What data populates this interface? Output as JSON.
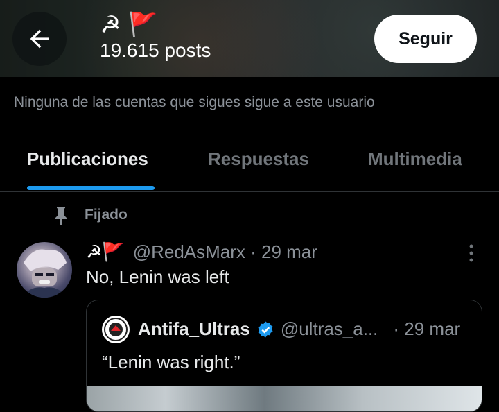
{
  "header": {
    "title_hammer_sickle": "☭",
    "title_flag": "🚩",
    "posts_count": "19.615 posts",
    "follow_label": "Seguir"
  },
  "follows_note": "Ninguna de las cuentas que sigues sigue a este usuario",
  "tabs": [
    {
      "label": "Publicaciones",
      "active": true
    },
    {
      "label": "Respuestas",
      "active": false
    },
    {
      "label": "Multimedia",
      "active": false
    }
  ],
  "pinned_label": "Fijado",
  "tweet": {
    "name_hammer_sickle": "☭",
    "name_flag": "🚩",
    "handle_time": "@RedAsMarx · 29 mar",
    "text": "No, Lenin was left",
    "quote": {
      "name": "Antifa_Ultras",
      "handle": "@ultras_a...",
      "time": "· 29 mar",
      "text": "“Lenin was right.”"
    }
  },
  "colors": {
    "accent": "#1d9bf0",
    "flag_red": "#e0242b",
    "muted": "#71767b"
  }
}
